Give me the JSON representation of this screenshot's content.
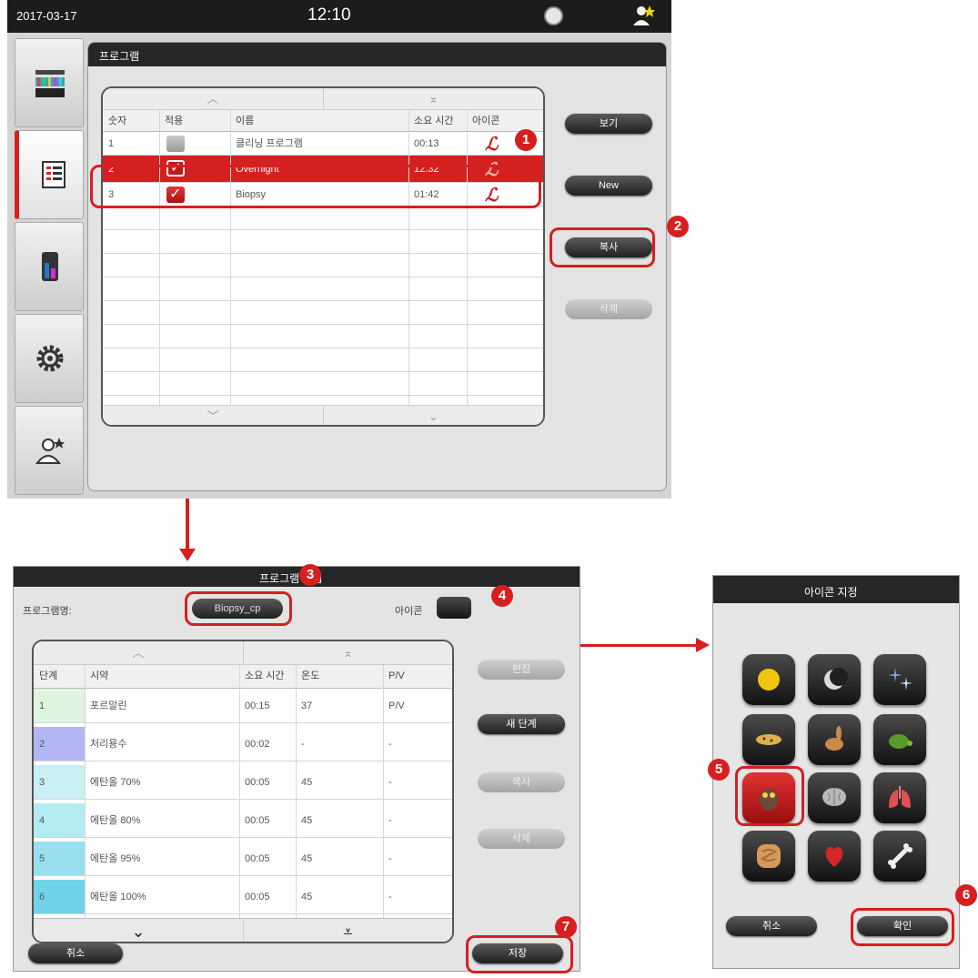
{
  "status_bar": {
    "date": "2017-03-17",
    "time": "12:10"
  },
  "programs_panel": {
    "title": "프로그램",
    "columns": [
      "숫자",
      "적용",
      "이름",
      "소요 시간",
      "아이콘"
    ],
    "rows": [
      {
        "number": "1",
        "applied": false,
        "name": "클리닝 프로그램",
        "duration": "00:13",
        "icon": "leica-script-icon",
        "selected": false
      },
      {
        "number": "2",
        "applied": true,
        "name": "Overnight",
        "duration": "12:32",
        "icon": "leica-script-icon",
        "selected": true
      },
      {
        "number": "3",
        "applied": true,
        "name": "Biopsy",
        "duration": "01:42",
        "icon": "leica-script-icon",
        "selected": false
      }
    ],
    "buttons": {
      "view": "보기",
      "new": "New",
      "copy": "복사",
      "delete": "삭제"
    }
  },
  "sidebar": {
    "items": [
      {
        "name": "reagent-status-icon",
        "active": false
      },
      {
        "name": "program-list-icon",
        "active": true
      },
      {
        "name": "reagent-bottles-icon",
        "active": false
      },
      {
        "name": "settings-gear-icon",
        "active": false
      },
      {
        "name": "user-admin-icon",
        "active": false
      }
    ]
  },
  "edit_panel": {
    "title": "프로그램 편집",
    "program_name_label": "프로그램명:",
    "program_name_value": "Biopsy_cp",
    "icon_label": "아이콘",
    "columns": [
      "단계",
      "시약",
      "소요 시간",
      "온도",
      "P/V"
    ],
    "steps": [
      {
        "step": "1",
        "reagent": "포르말린",
        "duration": "00:15",
        "temp": "37",
        "pv": "P/V",
        "color": "#dff5df"
      },
      {
        "step": "2",
        "reagent": "처리용수",
        "duration": "00:02",
        "temp": "-",
        "pv": "-",
        "color": "#b3b6f5"
      },
      {
        "step": "3",
        "reagent": "에탄올 70%",
        "duration": "00:05",
        "temp": "45",
        "pv": "-",
        "color": "#c8f0f5"
      },
      {
        "step": "4",
        "reagent": "에탄올 80%",
        "duration": "00:05",
        "temp": "45",
        "pv": "-",
        "color": "#b4eaf2"
      },
      {
        "step": "5",
        "reagent": "에탄올 95%",
        "duration": "00:05",
        "temp": "45",
        "pv": "-",
        "color": "#98e0ef"
      },
      {
        "step": "6",
        "reagent": "에탄올 100%",
        "duration": "00:05",
        "temp": "45",
        "pv": "-",
        "color": "#6fd4ea"
      }
    ],
    "buttons": {
      "edit": "편집",
      "new_step": "새 단계",
      "copy": "복사",
      "delete": "삭제",
      "cancel": "취소",
      "save": "저장"
    }
  },
  "icon_dialog": {
    "title": "아이콘 지정",
    "icons": [
      "sun-icon",
      "moon-icon",
      "stars-icon",
      "cheetah-icon",
      "rabbit-icon",
      "turtle-icon",
      "owl-icon",
      "brain-icon",
      "lungs-icon",
      "intestine-icon",
      "heart-icon",
      "bone-icon"
    ],
    "selected_index": 6,
    "buttons": {
      "cancel": "취소",
      "ok": "확인"
    }
  },
  "callouts": [
    "1",
    "2",
    "3",
    "4",
    "5",
    "6",
    "7"
  ],
  "colors": {
    "accent_red": "#d61f1f",
    "header_dark": "#262626"
  }
}
